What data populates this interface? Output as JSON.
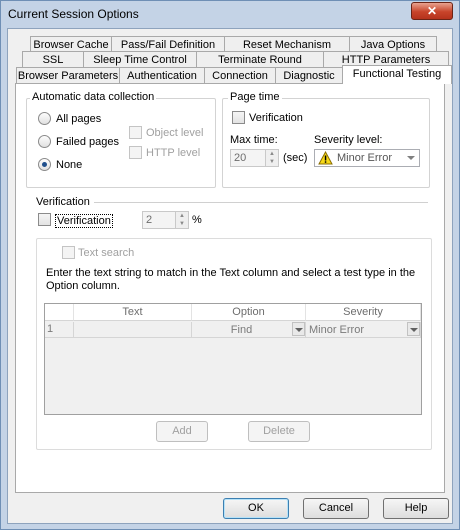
{
  "window": {
    "title": "Current Session Options",
    "close_label": "✕"
  },
  "tabs": {
    "row1": [
      "Browser Cache",
      "Pass/Fail Definition",
      "Reset Mechanism",
      "Java Options"
    ],
    "row2": [
      "SSL",
      "Sleep Time Control",
      "Terminate Round",
      "HTTP Parameters"
    ],
    "row3": [
      "Browser Parameters",
      "Authentication",
      "Connection",
      "Diagnostic",
      "Functional Testing"
    ],
    "active": "Functional Testing"
  },
  "auto_collection": {
    "title": "Automatic data collection",
    "all_pages": "All pages",
    "failed_pages": "Failed pages",
    "none": "None",
    "object_level": "Object level",
    "http_level": "HTTP level",
    "selected": "None"
  },
  "page_time": {
    "title": "Page time",
    "verification": "Verification",
    "max_time_label": "Max time:",
    "max_time_value": "20",
    "unit": "(sec)",
    "severity_label": "Severity level:",
    "severity_value": "Minor Error"
  },
  "verification": {
    "title": "Verification",
    "checkbox_label": "Verification",
    "value": "2",
    "unit": "%",
    "text_search": "Text search",
    "instructions": "Enter the text string to match in the Text column and select a test type in the Option column.",
    "columns": [
      "Text",
      "Option",
      "Severity"
    ],
    "rows": [
      {
        "num": "1",
        "text": "",
        "option": "Find",
        "severity": "Minor Error"
      }
    ],
    "add_label": "Add",
    "delete_label": "Delete"
  },
  "footer": {
    "ok": "OK",
    "cancel": "Cancel",
    "help": "Help"
  },
  "colors": {
    "frame": "#c4d3e6",
    "close": "#c8442a",
    "warning": "#f7d917"
  }
}
